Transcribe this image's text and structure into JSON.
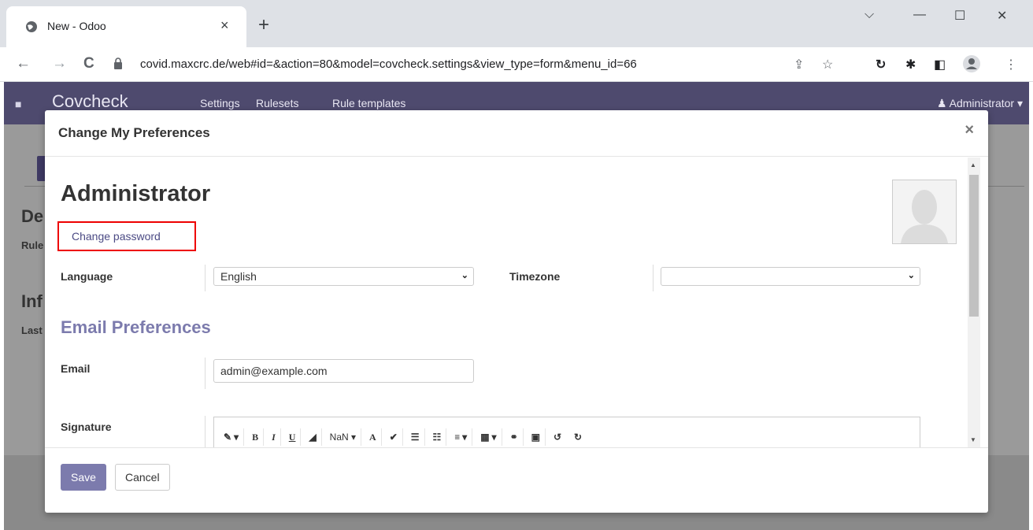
{
  "browser": {
    "tab_title": "New - Odoo",
    "tab_close": "×",
    "new_tab": "+",
    "url": "covid.maxcrc.de/web#id=&action=80&model=covcheck.settings&view_type=form&menu_id=66",
    "controls": {
      "minimize": "—",
      "maximize": "☐",
      "close": "✕",
      "down": "⌵"
    },
    "nav": {
      "back": "←",
      "forward": "→",
      "reload": "C"
    }
  },
  "odoo_nav": {
    "brand": "Covcheck",
    "menu": [
      "Settings",
      "Rulesets",
      "Rule templates"
    ],
    "user": "Administrator"
  },
  "background": {
    "texts": [
      "De",
      "Rule",
      "Inf",
      "Last"
    ]
  },
  "modal": {
    "title": "Change My Preferences",
    "close": "×",
    "name": "Administrator",
    "change_password": "Change password",
    "language_label": "Language",
    "language_value": "English",
    "timezone_label": "Timezone",
    "timezone_value": "",
    "email_section": "Email Preferences",
    "email_label": "Email",
    "email_value": "admin@example.com",
    "signature_label": "Signature",
    "editor_toolbar": [
      "✎ ▾",
      "B",
      "I",
      "U",
      "◢",
      "NaN ▾",
      "A",
      "✔",
      "☰",
      "☷",
      "≡ ▾",
      "▦ ▾",
      "⚭",
      "▣",
      "↺",
      "↻"
    ],
    "save": "Save",
    "cancel": "Cancel"
  },
  "colors": {
    "brand": "#7c7bad",
    "highlight": "#e00000"
  }
}
